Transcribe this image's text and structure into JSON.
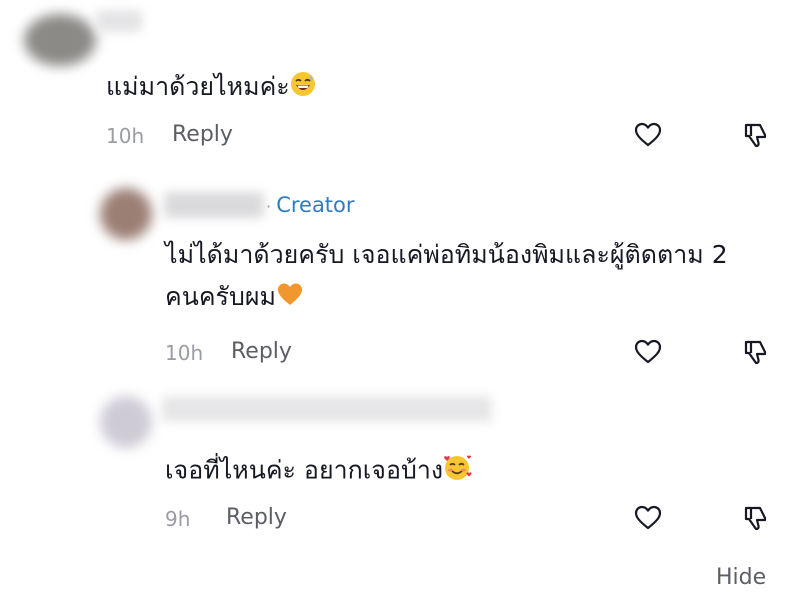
{
  "comments": [
    {
      "text": "แม่มาด้วยไหมค่ะ",
      "emoji": "grinning-sweat-emoji",
      "time": "10h",
      "reply_label": "Reply"
    },
    {
      "badge_text": "Creator",
      "text_line1": "ไม่ได้มาด้วยครับ เจอแค่พ่อทิมน้องพิมและผู้ติดตาม 2",
      "text_line2": "คนครับผม",
      "emoji": "orange-heart-emoji",
      "time": "10h",
      "reply_label": "Reply"
    },
    {
      "text": "เจอที่ไหนค่ะ อยากเจอบ้าง",
      "emoji": "smiling-face-with-hearts-emoji",
      "time": "9h",
      "reply_label": "Reply"
    }
  ],
  "hide_label": "Hide",
  "colors": {
    "text": "#161823",
    "secondary": "#5c5e66",
    "time": "#9a9ca3",
    "creator": "#2f7cc4",
    "icon": "#161823"
  }
}
